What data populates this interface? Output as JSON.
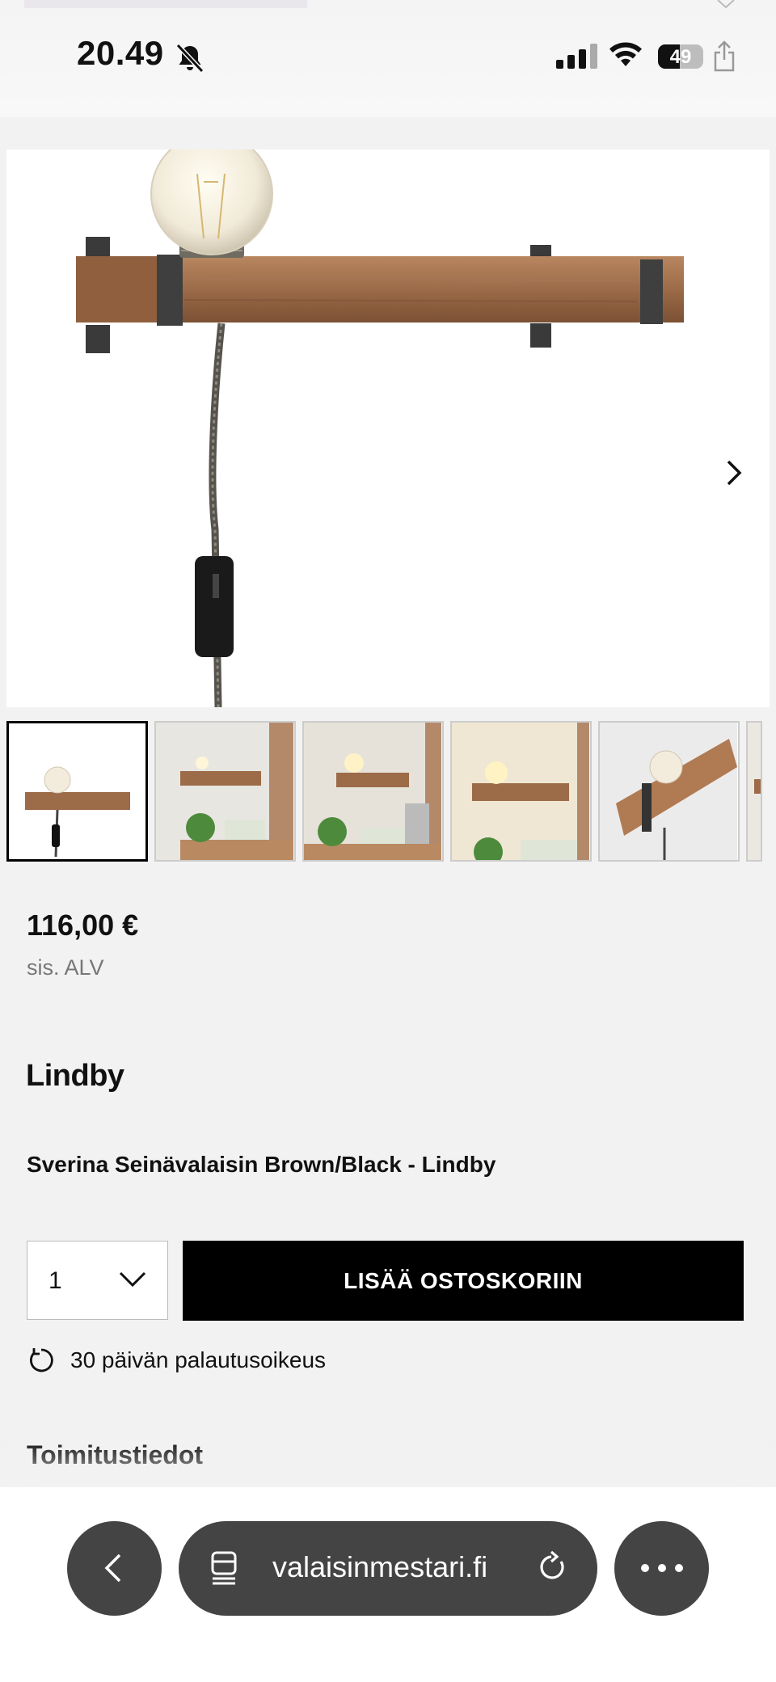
{
  "status_bar": {
    "time": "20.49",
    "battery_level": "49",
    "battery_fraction": 0.49,
    "icons": [
      "bell-slash-icon",
      "cellular-signal-icon",
      "wifi-icon",
      "battery-icon",
      "share-icon"
    ]
  },
  "gallery": {
    "next_icon": "chevron-right-icon",
    "thumbnails_count": 6,
    "selected_index": 0
  },
  "product": {
    "price": "116,00 €",
    "vat_note": "sis. ALV",
    "brand": "Lindby",
    "title": "Sverina Seinävalaisin Brown/Black - Lindby"
  },
  "purchase": {
    "quantity": "1",
    "add_to_cart_label": "LISÄÄ OSTOSKORIIN"
  },
  "returns_note": "30 päivän palautusoikeus",
  "delivery_heading": "Toimitustiedot",
  "browser": {
    "url": "valaisinmestari.fi",
    "icons": [
      "back-icon",
      "tabs-icon",
      "reload-icon",
      "more-icon"
    ]
  },
  "colors": {
    "background": "#f2f2f2",
    "button": "#000000",
    "browser_pill": "#444444",
    "wood": "#9c6b48"
  }
}
